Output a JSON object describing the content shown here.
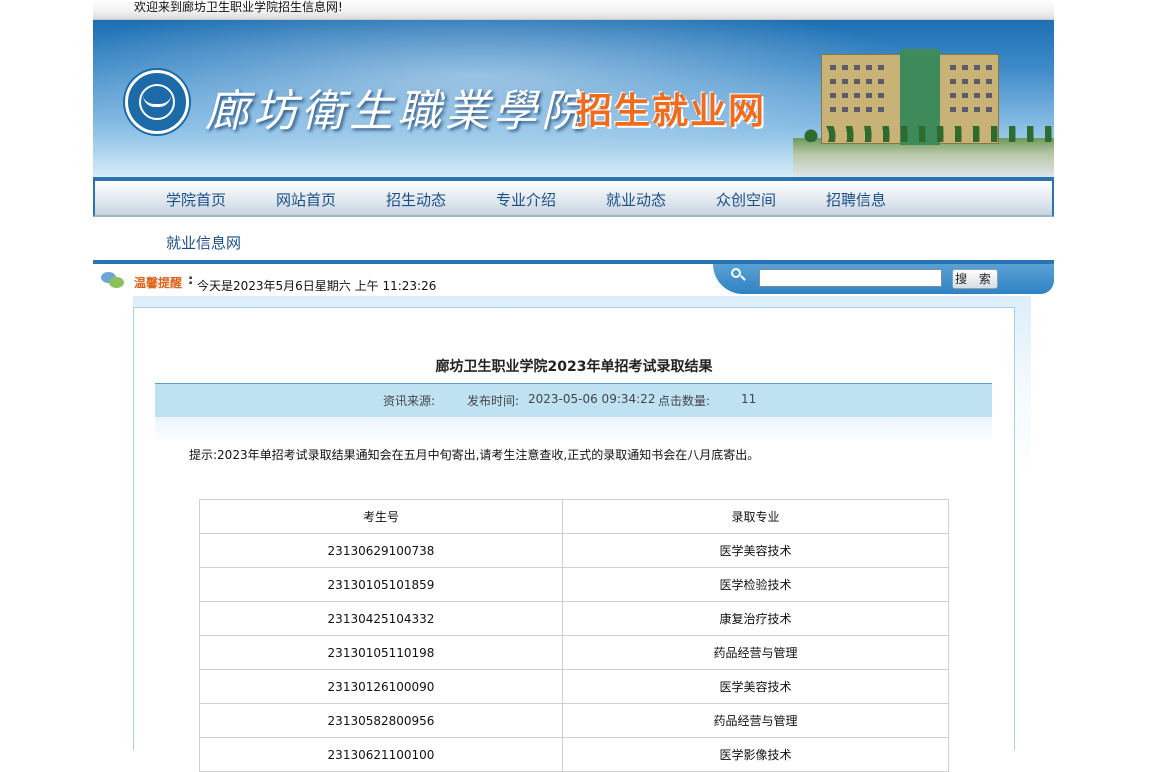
{
  "topbar": {
    "welcome": "欢迎来到廊坊卫生职业学院招生信息网!"
  },
  "banner": {
    "college_name": "廊坊衛生職業學院",
    "site_name": "招生就业网"
  },
  "nav": {
    "items": [
      {
        "label": "学院首页"
      },
      {
        "label": "网站首页"
      },
      {
        "label": "招生动态"
      },
      {
        "label": "专业介绍"
      },
      {
        "label": "就业动态"
      },
      {
        "label": "众创空间"
      },
      {
        "label": "招聘信息"
      },
      {
        "label": "就业信息网"
      }
    ]
  },
  "reminder": {
    "label": "温馨提醒",
    "colon": ":",
    "text": "今天是2023年5月6日星期六 上午 11:23:26"
  },
  "search": {
    "value": "",
    "button_label": "搜 索"
  },
  "article": {
    "title": "廊坊卫生职业学院2023年单招考试录取结果",
    "source_label": "资讯来源:",
    "publish_label": "发布时间:",
    "publish_time": "2023-05-06 09:34:22",
    "clicks_label": "点击数量:",
    "clicks": "11",
    "notice": "提示:2023年单招考试录取结果通知会在五月中旬寄出,请考生注意查收,正式的录取通知书会在八月底寄出。"
  },
  "table": {
    "headers": [
      "考生号",
      "录取专业"
    ],
    "rows": [
      [
        "23130629100738",
        "医学美容技术"
      ],
      [
        "23130105101859",
        "医学检验技术"
      ],
      [
        "23130425104332",
        "康复治疗技术"
      ],
      [
        "23130105110198",
        "药品经营与管理"
      ],
      [
        "23130126100090",
        "医学美容技术"
      ],
      [
        "23130582800956",
        "药品经营与管理"
      ],
      [
        "23130621100100",
        "医学影像技术"
      ]
    ]
  }
}
